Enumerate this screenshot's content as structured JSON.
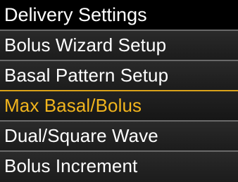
{
  "screen": {
    "title": "Delivery Settings"
  },
  "menu": {
    "items": [
      {
        "label": "Bolus Wizard Setup",
        "selected": false
      },
      {
        "label": "Basal Pattern Setup",
        "selected": false
      },
      {
        "label": "Max Basal/Bolus",
        "selected": true
      },
      {
        "label": "Dual/Square Wave",
        "selected": false
      },
      {
        "label": "Bolus Increment",
        "selected": false
      }
    ]
  },
  "colors": {
    "background": "#000000",
    "text": "#ffffff",
    "selected_text": "#f2b51d",
    "selected_border": "#d9a21a",
    "divider": "#6a6a6a"
  }
}
